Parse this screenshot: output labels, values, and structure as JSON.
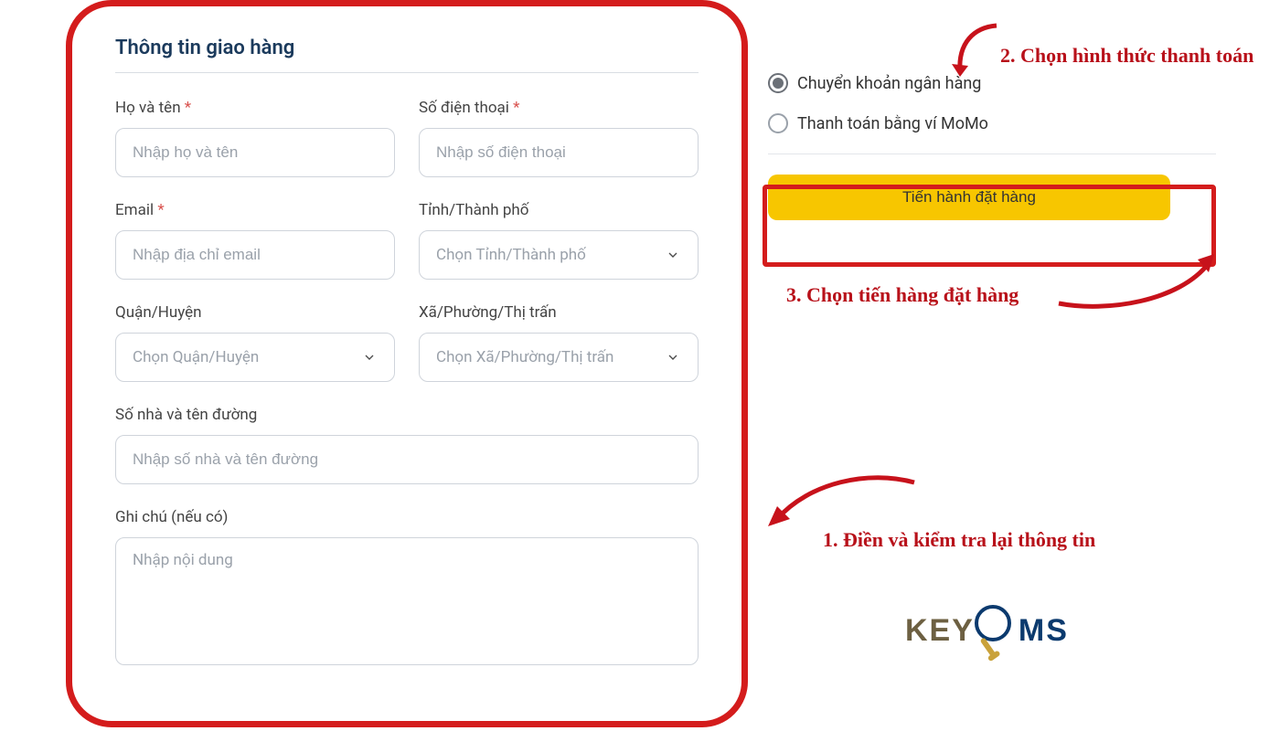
{
  "form": {
    "title": "Thông tin giao hàng",
    "fields": {
      "name": {
        "label": "Họ và tên",
        "required": true,
        "placeholder": "Nhập họ và tên"
      },
      "phone": {
        "label": "Số điện thoại",
        "required": true,
        "placeholder": "Nhập số điện thoại"
      },
      "email": {
        "label": "Email",
        "required": true,
        "placeholder": "Nhập địa chỉ email"
      },
      "city": {
        "label": "Tỉnh/Thành phố",
        "required": false,
        "placeholder": "Chọn Tỉnh/Thành phố"
      },
      "district": {
        "label": "Quận/Huyện",
        "required": false,
        "placeholder": "Chọn Quận/Huyện"
      },
      "ward": {
        "label": "Xã/Phường/Thị trấn",
        "required": false,
        "placeholder": "Chọn Xã/Phường/Thị trấn"
      },
      "street": {
        "label": "Số nhà và tên đường",
        "required": false,
        "placeholder": "Nhập số nhà và tên đường"
      },
      "note": {
        "label": "Ghi chú (nếu có)",
        "required": false,
        "placeholder": "Nhập nội dung"
      }
    }
  },
  "payment": {
    "options": [
      {
        "label": "Chuyển khoản ngân hàng",
        "selected": true
      },
      {
        "label": "Thanh toán bằng ví MoMo",
        "selected": false
      }
    ],
    "cta": "Tiến hành đặt hàng"
  },
  "annotations": {
    "step1": "1. Điền và kiểm tra lại thông tin",
    "step2": "2. Chọn hình thức thanh toán",
    "step3": "3. Chọn tiến hàng đặt hàng"
  },
  "logo": {
    "part1": "KEY",
    "part2": "MS"
  },
  "required_marker": "*"
}
